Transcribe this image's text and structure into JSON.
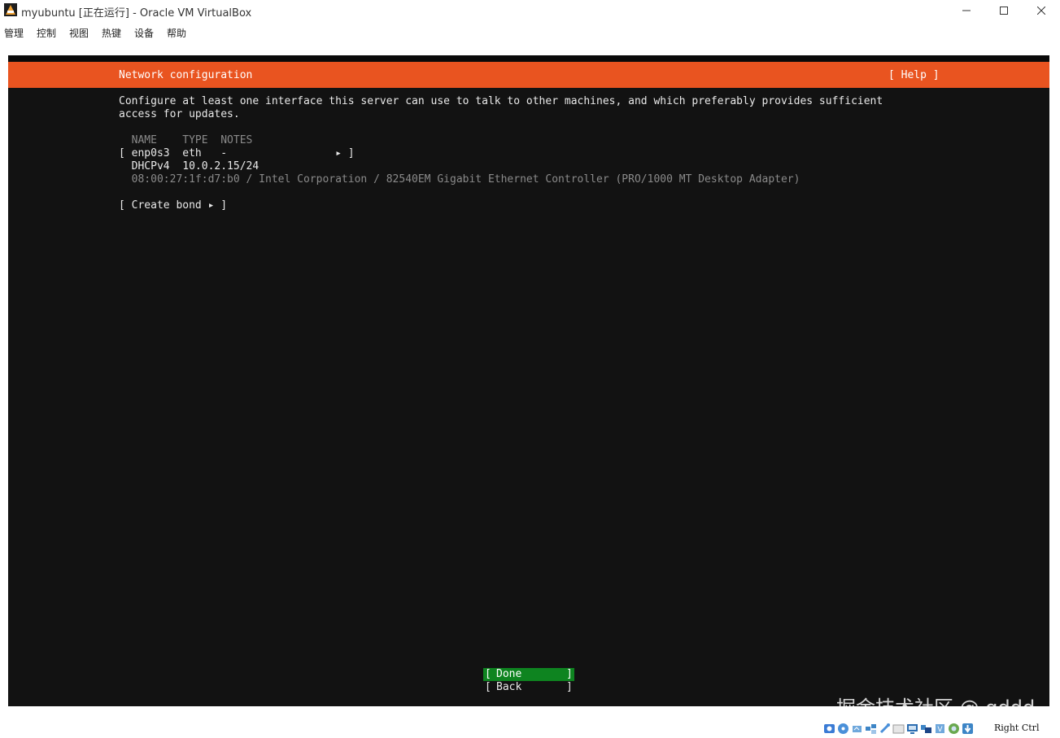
{
  "window": {
    "title": "myubuntu [正在运行] - Oracle VM VirtualBox",
    "controls": {
      "minimize": "—",
      "maximize": "☐",
      "close": "✕"
    }
  },
  "menu": [
    "管理",
    "控制",
    "视图",
    "热键",
    "设备",
    "帮助"
  ],
  "installer": {
    "header_title": "Network configuration",
    "help_label": "[ Help ]",
    "description_line1": "Configure at least one interface this server can use to talk to other machines, and which preferably provides sufficient",
    "description_line2": "access for updates.",
    "table_header": "  NAME    TYPE  NOTES",
    "interface_row": "[ enp0s3  eth   -                 ▸ ]",
    "dhcp_row": "  DHCPv4  10.0.2.15/24",
    "hw_row": "  08:00:27:1f:d7:b0 / Intel Corporation / 82540EM Gigabit Ethernet Controller (PRO/1000 MT Desktop Adapter)",
    "create_bond": "[ Create bond ▸ ]",
    "done_button": {
      "open": "[",
      "label": "Done",
      "close": "]"
    },
    "back_button": {
      "open": "[",
      "label": "Back",
      "close": "]"
    },
    "colors": {
      "header": "#e95420",
      "background": "#121212",
      "done": "#0e8420"
    }
  },
  "watermark": "掘金技术社区 @ qddd",
  "statusbar": {
    "icons": [
      "hdd-icon",
      "optical-icon",
      "audio-icon",
      "network-icon",
      "usb-icon",
      "shared-folder-icon",
      "display-icon",
      "recording-icon",
      "cpu-icon",
      "mouse-integration-icon",
      "keyboard-icon"
    ],
    "host_key": "Right Ctrl"
  }
}
